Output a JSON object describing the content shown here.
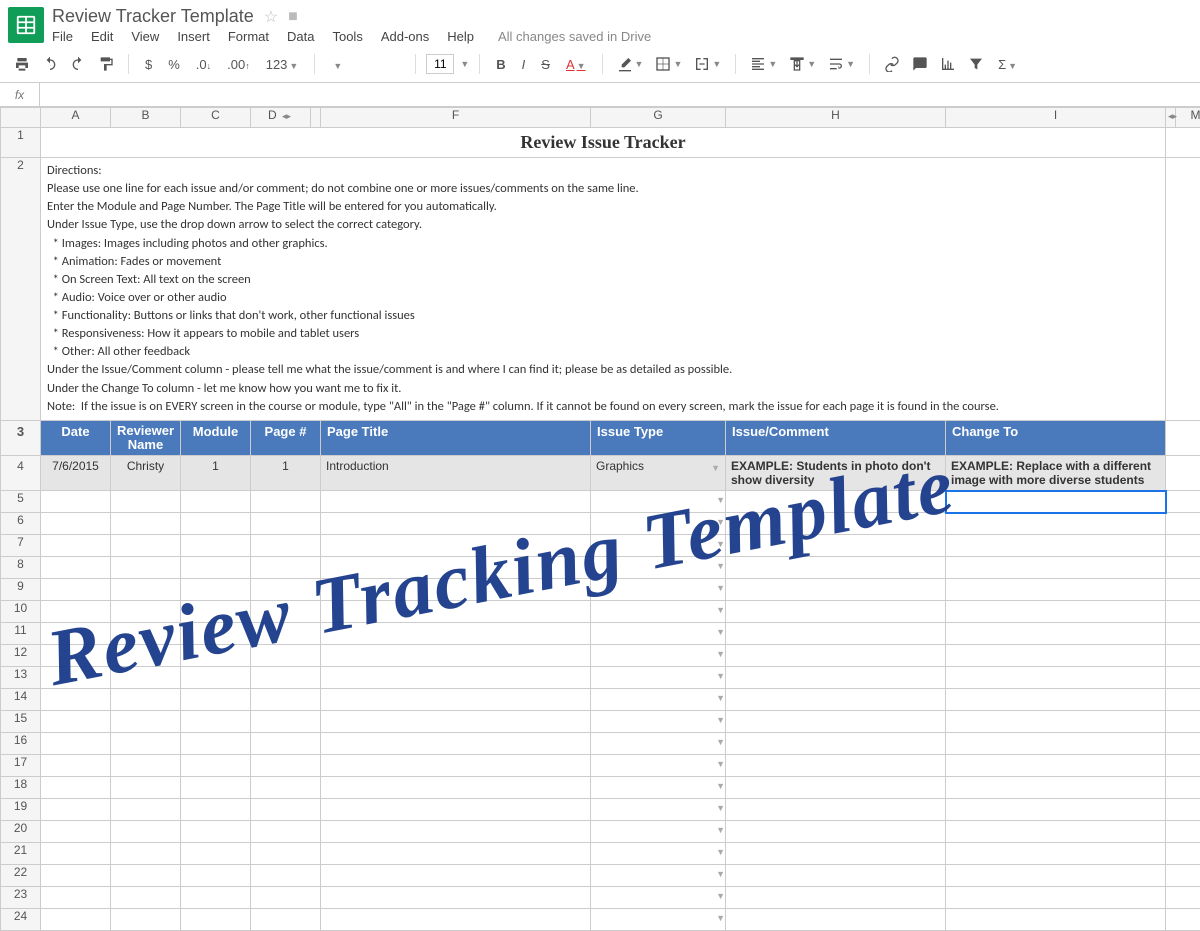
{
  "header": {
    "doc_title": "Review Tracker Template",
    "menus": [
      "File",
      "Edit",
      "View",
      "Insert",
      "Format",
      "Data",
      "Tools",
      "Add-ons",
      "Help"
    ],
    "save_status": "All changes saved in Drive"
  },
  "toolbar": {
    "currency": "$",
    "percent": "%",
    "dec_dec": ".0",
    "dec_inc": ".00",
    "num_format": "123",
    "font_size": "11",
    "bold": "B",
    "italic": "I",
    "strike": "S",
    "underline_a": "A"
  },
  "formula_bar": {
    "fx": "fx",
    "value": ""
  },
  "columns": [
    "A",
    "B",
    "C",
    "D",
    "",
    "F",
    "G",
    "H",
    "I",
    "",
    "M"
  ],
  "sheet": {
    "title": "Review Issue Tracker",
    "directions": "Directions:\nPlease use one line for each issue and/or comment; do not combine one or more issues/comments on the same line.\nEnter the Module and Page Number. The Page Title will be entered for you automatically.\nUnder Issue Type, use the drop down arrow to select the correct category.\n  * Images: Images including photos and other graphics.\n  * Animation: Fades or movement\n  * On Screen Text: All text on the screen\n  * Audio: Voice over or other audio\n  * Functionality: Buttons or links that don't work, other functional issues\n  * Responsiveness: How it appears to mobile and tablet users\n  * Other: All other feedback\nUnder the Issue/Comment column - please tell me what the issue/comment is and where I can find it; please be as detailed as possible.\nUnder the Change To column - let me know how you want me to fix it.\nNote:  If the issue is on EVERY screen in the course or module, type \"All\" in the \"Page #\" column. If it cannot be found on every screen, mark the issue for each page it is found in the course.",
    "headers": {
      "date": "Date",
      "reviewer": "Reviewer Name",
      "module": "Module",
      "page": "Page #",
      "page_title": "Page Title",
      "issue_type": "Issue Type",
      "issue_comment": "Issue/Comment",
      "change_to": "Change To"
    },
    "example": {
      "date": "7/6/2015",
      "reviewer": "Christy",
      "module": "1",
      "page": "1",
      "page_title": "Introduction",
      "issue_type": "Graphics",
      "issue_comment": "EXAMPLE: Students in photo don't show diversity",
      "change_to": "EXAMPLE: Replace with a different image with more diverse students"
    }
  },
  "watermark": "Review Tracking Template",
  "row_numbers": [
    "1",
    "2",
    "3",
    "4",
    "5",
    "6",
    "7",
    "8",
    "9",
    "10",
    "11",
    "12",
    "13",
    "14",
    "15",
    "16",
    "17",
    "18",
    "19",
    "20",
    "21",
    "22",
    "23",
    "24"
  ]
}
